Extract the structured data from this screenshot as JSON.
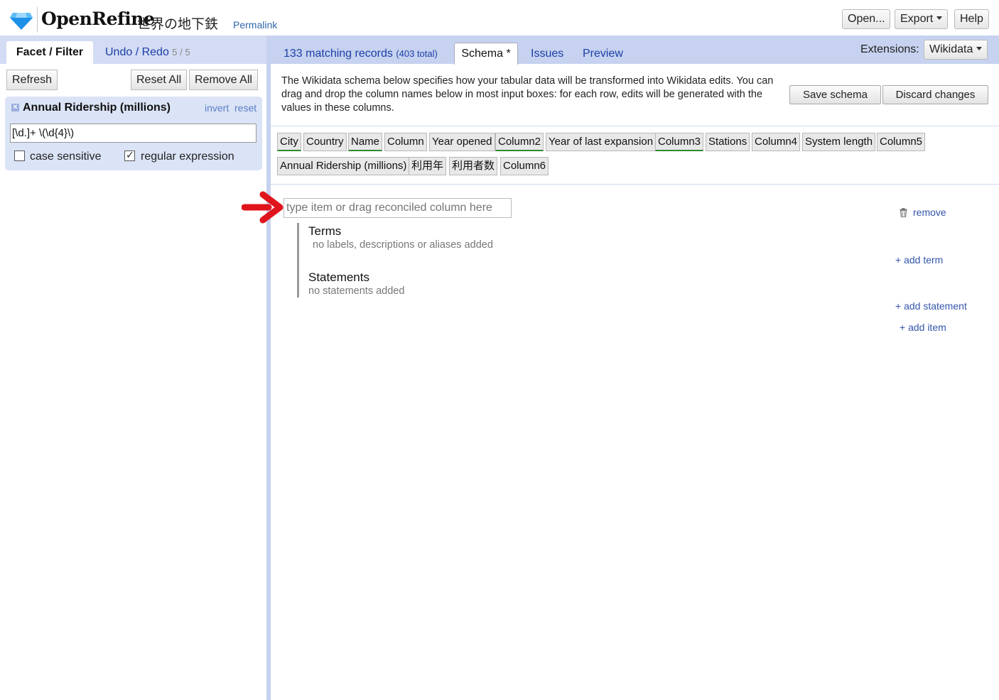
{
  "header": {
    "app_name": "OpenRefine",
    "project_name": "世界の地下鉄",
    "permalink": "Permalink",
    "open_label": "Open...",
    "export_label": "Export",
    "help_label": "Help"
  },
  "left": {
    "tab_facet": "Facet / Filter",
    "tab_undo": "Undo / Redo",
    "undo_count": "5 / 5",
    "refresh": "Refresh",
    "reset_all": "Reset All",
    "remove_all": "Remove All",
    "facet": {
      "title": "Annual Ridership (millions)",
      "invert": "invert",
      "reset": "reset",
      "value": "[\\d.]+ \\(\\d{4}\\)",
      "case_sensitive_label": "case sensitive",
      "case_sensitive": false,
      "regex_label": "regular expression",
      "regex": true
    }
  },
  "right": {
    "records_count": "133 matching records",
    "records_total": "(403 total)",
    "tab_schema": "Schema *",
    "tab_issues": "Issues",
    "tab_preview": "Preview",
    "extensions_label": "Extensions:",
    "extensions_value": "Wikidata",
    "description": "The Wikidata schema below specifies how your tabular data will be transformed into Wikidata edits. You can drag and drop the column names below in most input boxes: for each row, edits will be generated with the values in these columns.",
    "save_schema": "Save schema",
    "discard_changes": "Discard changes",
    "columns": [
      {
        "name": "City",
        "reconciled": true
      },
      {
        "name": "Country",
        "reconciled": false
      },
      {
        "name": "Name",
        "reconciled": true
      },
      {
        "name": "Column",
        "reconciled": false
      },
      {
        "name": "Year opened",
        "reconciled": false
      },
      {
        "name": "Column2",
        "reconciled": true
      },
      {
        "name": "Year of last expansion",
        "reconciled": false
      },
      {
        "name": "Column3",
        "reconciled": true
      },
      {
        "name": "Stations",
        "reconciled": false
      },
      {
        "name": "Column4",
        "reconciled": false
      },
      {
        "name": "System length",
        "reconciled": false
      },
      {
        "name": "Column5",
        "reconciled": false
      },
      {
        "name": "Annual Ridership (millions)",
        "reconciled": false
      },
      {
        "name": "利用年",
        "reconciled": false
      },
      {
        "name": "利用者数",
        "reconciled": false
      },
      {
        "name": "Column6",
        "reconciled": false
      }
    ],
    "item_placeholder": "type item or drag reconciled column here",
    "remove": "remove",
    "terms_title": "Terms",
    "terms_empty": "no labels, descriptions or aliases added",
    "add_term": "+ add term",
    "statements_title": "Statements",
    "statements_empty": "no statements added",
    "add_statement": "+ add statement",
    "add_item": "+ add item"
  },
  "colors": {
    "tab_bar": "#c6d2ef",
    "link": "#1c3fa8",
    "reconciled_underline": "#2f8a2f",
    "arrow": "#e0141c"
  }
}
